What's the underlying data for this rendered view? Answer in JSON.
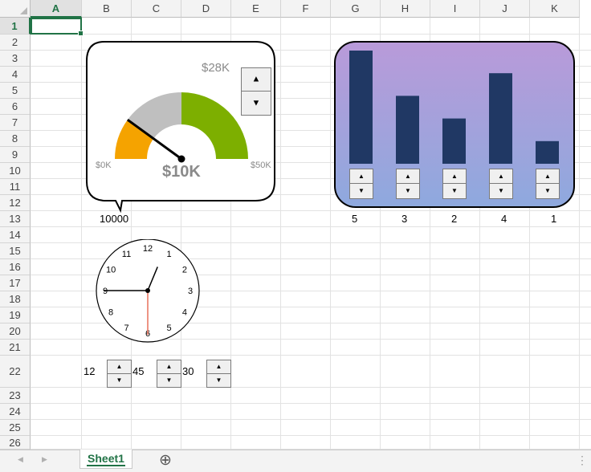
{
  "columns": [
    "A",
    "B",
    "C",
    "D",
    "E",
    "F",
    "G",
    "H",
    "I",
    "J",
    "K"
  ],
  "rows": [
    "1",
    "2",
    "3",
    "4",
    "5",
    "6",
    "7",
    "8",
    "9",
    "10",
    "11",
    "12",
    "13",
    "14",
    "15",
    "16",
    "17",
    "18",
    "19",
    "20",
    "21",
    "22",
    "23",
    "24",
    "25",
    "26"
  ],
  "selected_cell": "A1",
  "gauge": {
    "value_label": "$10K",
    "min_label": "$0K",
    "max_label": "$50K",
    "target_label": "$28K",
    "value": 10000,
    "min": 0,
    "max": 50000,
    "target": 28000,
    "colors": {
      "low": "#f5a300",
      "mid": "#bfbfbf",
      "high": "#7daf00",
      "needle": "#000000"
    },
    "cell_value": "10000"
  },
  "bar_panel": {
    "bars": [
      5,
      3,
      2,
      4,
      1
    ],
    "max": 5,
    "bar_color": "#203864",
    "bg_top": "#b99ad9",
    "bg_bottom": "#8ea9de"
  },
  "clock": {
    "numbers": [
      "12",
      "1",
      "2",
      "3",
      "4",
      "5",
      "6",
      "7",
      "8",
      "9",
      "10",
      "11"
    ],
    "hour": 12,
    "minute": 45,
    "second": 30,
    "second_hand_color": "#e8705a"
  },
  "time_inputs": {
    "hour_value": "12",
    "minute_value": "45",
    "second_value": "30"
  },
  "spin_glyphs": {
    "up": "▲",
    "down": "▼"
  },
  "sheet_tabs": [
    "Sheet1"
  ],
  "icons": {
    "add_sheet": "⊕",
    "nav_prev": "◀",
    "nav_next": "▶",
    "menu": "⋮"
  }
}
